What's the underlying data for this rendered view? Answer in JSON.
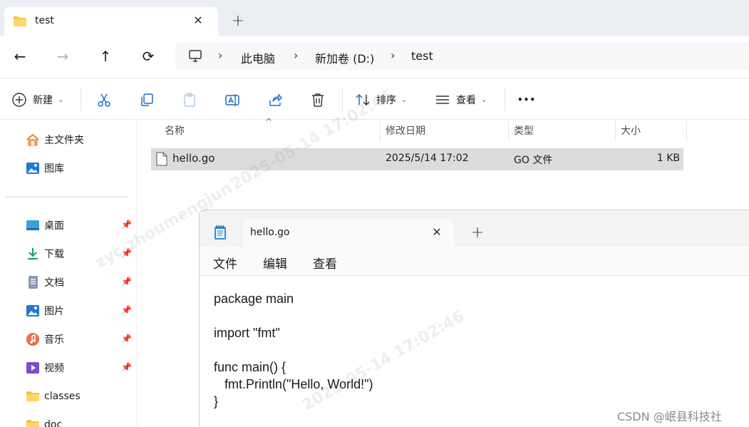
{
  "explorer": {
    "tab": {
      "title": "test",
      "close_glyph": "✕"
    },
    "newtab_glyph": "+",
    "nav": {
      "back": "←",
      "forward": "→",
      "up": "↑",
      "refresh": "⟳",
      "sep": "›"
    },
    "breadcrumbs": [
      "此电脑",
      "新加卷 (D:)",
      "test"
    ],
    "commands": {
      "new_label": "新建",
      "sort_label": "排序",
      "view_label": "查看",
      "more_glyph": "•••",
      "chevron": "⌄"
    },
    "sidebar": {
      "quick": [
        {
          "label": "主文件夹",
          "icon": "home-icon"
        },
        {
          "label": "图库",
          "icon": "gallery-icon"
        }
      ],
      "pinned": [
        {
          "label": "桌面",
          "icon": "desktop-icon"
        },
        {
          "label": "下载",
          "icon": "download-icon"
        },
        {
          "label": "文档",
          "icon": "document-icon"
        },
        {
          "label": "图片",
          "icon": "pictures-icon"
        },
        {
          "label": "音乐",
          "icon": "music-icon"
        },
        {
          "label": "视频",
          "icon": "video-icon"
        }
      ],
      "folders": [
        {
          "label": "classes",
          "icon": "folder-icon"
        },
        {
          "label": "doc",
          "icon": "folder-icon"
        }
      ],
      "pin_glyph": "📌"
    },
    "columns": {
      "name": "名称",
      "modified": "修改日期",
      "type": "类型",
      "size": "大小",
      "sort_caret": "^"
    },
    "files": [
      {
        "name": "hello.go",
        "modified": "2025/5/14 17:02",
        "type": "GO 文件",
        "size": "1 KB"
      }
    ]
  },
  "notepad": {
    "tab_title": "hello.go",
    "close_glyph": "✕",
    "newtab_glyph": "+",
    "menu": [
      "文件",
      "编辑",
      "查看"
    ],
    "code": [
      "package main",
      "",
      "import \"fmt\"",
      "",
      "func main() {",
      "   fmt.Println(\"Hello, World!\")",
      "}"
    ]
  },
  "watermark": {
    "user": "zyc-zhoumengjun",
    "timestamp": "2025-05-14  17:02:46",
    "credit": "CSDN @岷县科技社"
  },
  "colors": {
    "accent": "#0067c0",
    "tabbar": "#ebeff3",
    "selection": "#dcdcdc",
    "folder": "#f6c342"
  }
}
